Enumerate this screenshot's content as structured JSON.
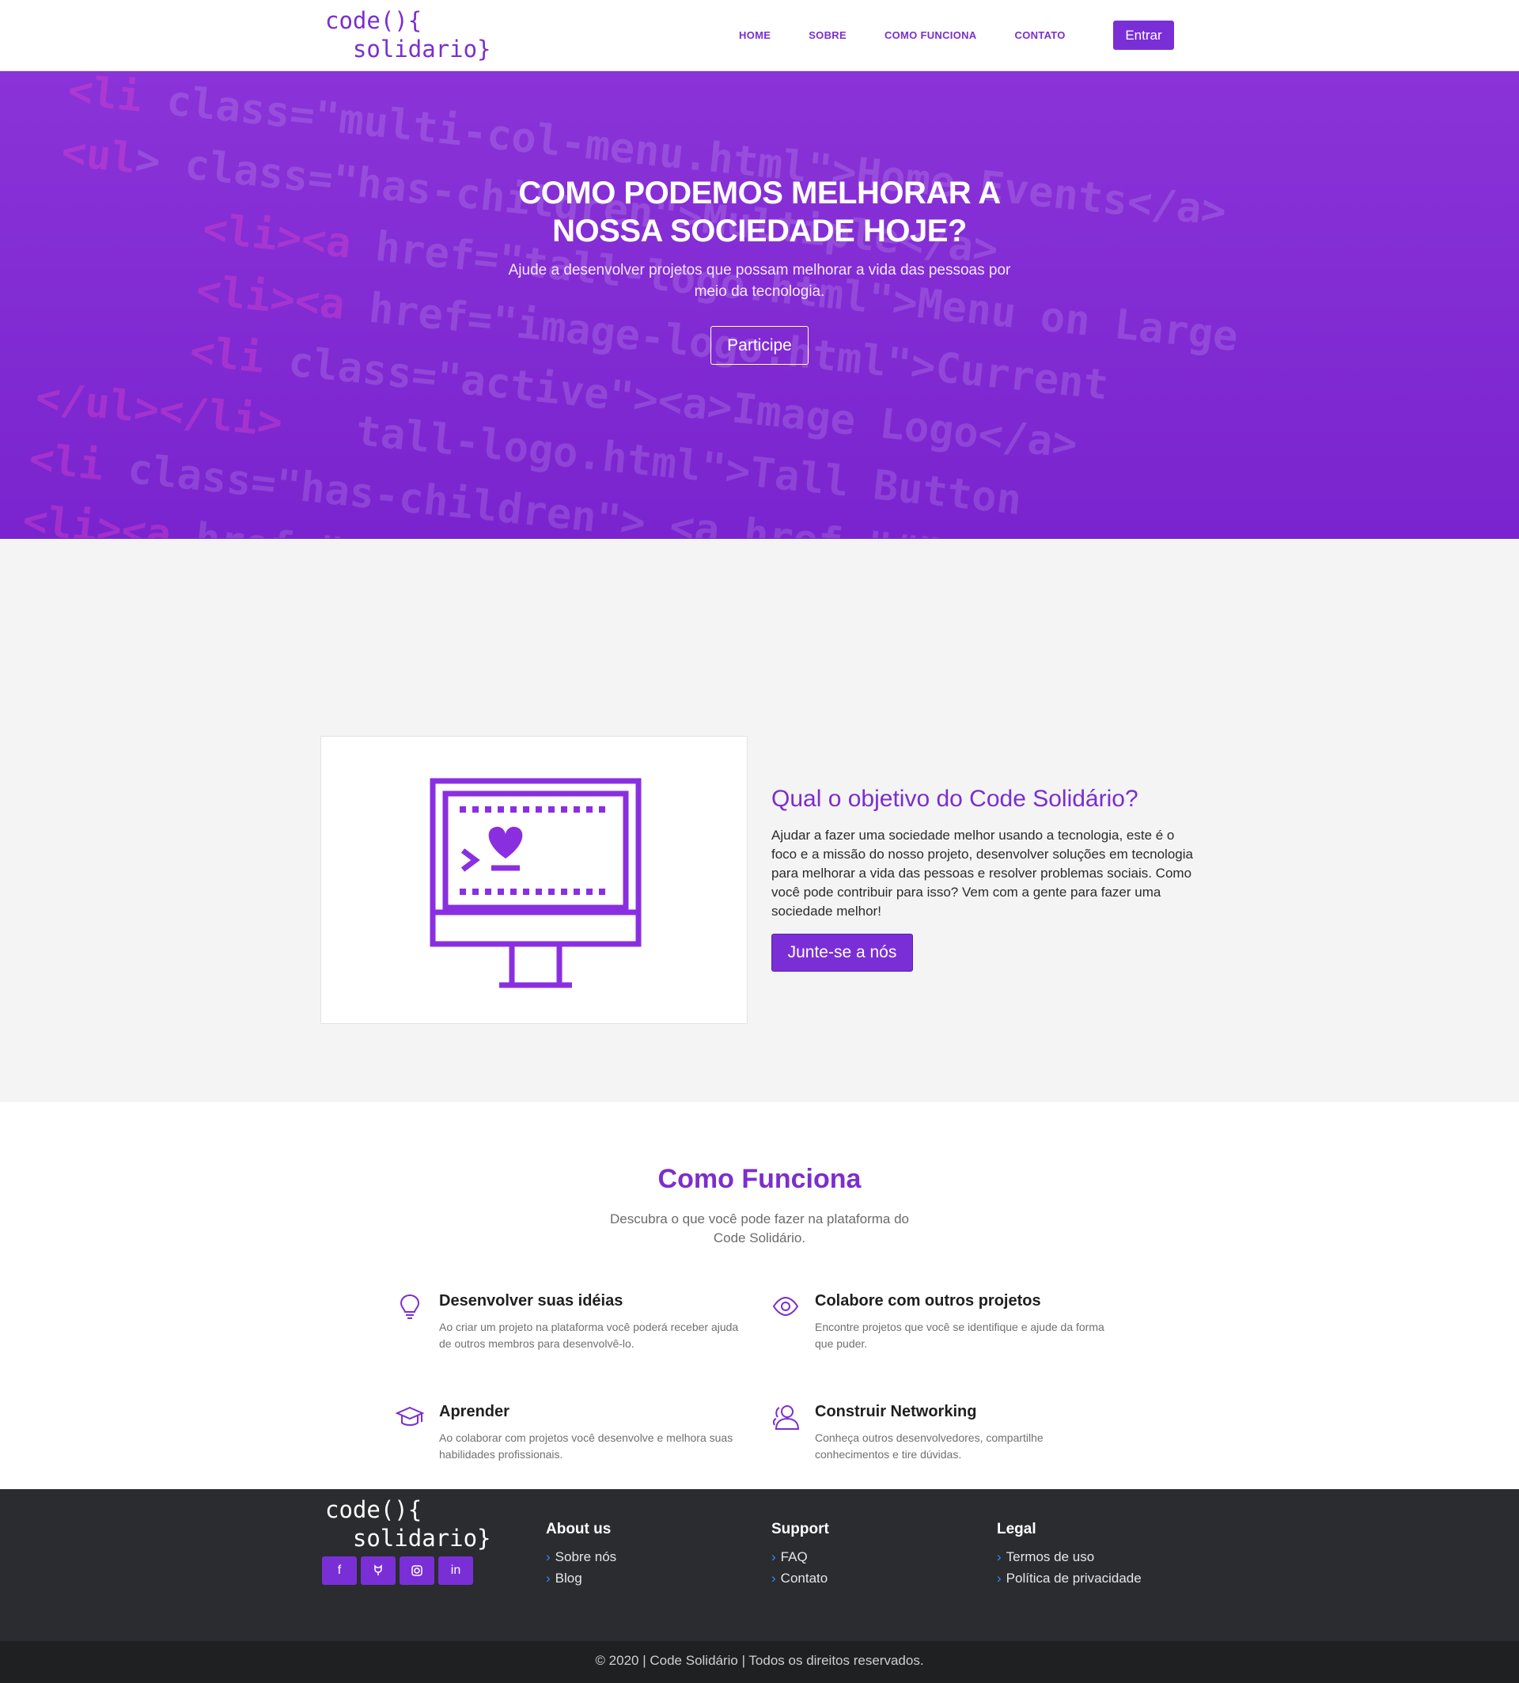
{
  "brand": {
    "logo_text": "code(){\n  solidario}",
    "accent_color": "#7a2fd6"
  },
  "nav": {
    "items": [
      "HOME",
      "SOBRE",
      "COMO FUNCIONA",
      "CONTATO"
    ],
    "login_label": "Entrar"
  },
  "hero": {
    "title_line1": "COMO PODEMOS MELHORAR A",
    "title_line2": "NOSSA SOCIEDADE HOJE?",
    "subtitle": "Ajude a desenvolver projetos que possam melhorar a vida das pessoas por meio da tecnologia.",
    "cta_label": "Participe"
  },
  "objetivo": {
    "illustration_icon": "computer-heart-icon",
    "title": "Qual o objetivo do Code Solidário?",
    "body": "Ajudar a fazer uma sociedade melhor usando a tecnologia, este é o foco e a missão do nosso projeto, desenvolver soluções em tecnologia para melhorar a vida das pessoas e resolver problemas sociais. Como você pode contribuir para isso? Vem com a gente para fazer uma sociedade melhor!",
    "cta_label": "Junte-se a nós"
  },
  "como_funciona": {
    "title": "Como Funciona",
    "subtitle": "Descubra o que você pode fazer na plataforma do Code Solidário.",
    "features": [
      {
        "icon": "lightbulb-icon",
        "title": "Desenvolver suas idéias",
        "body": "Ao criar um projeto na plataforma você poderá receber ajuda de outros membros para desenvolvê-lo."
      },
      {
        "icon": "eye-icon",
        "title": "Colabore com outros projetos",
        "body": "Encontre projetos que você se identifique e ajude da forma que puder."
      },
      {
        "icon": "graduation-cap-icon",
        "title": "Aprender",
        "body": "Ao colaborar com projetos você desenvolve e melhora suas habilidades profissionais."
      },
      {
        "icon": "users-icon",
        "title": "Construir Networking",
        "body": "Conheça outros desenvolvedores, compartilhe conhecimentos e tire dúvidas."
      }
    ]
  },
  "footer": {
    "logo_text": "code(){\n  solidario}",
    "socials": [
      "facebook-icon",
      "github-icon",
      "instagram-icon",
      "linkedin-icon"
    ],
    "columns": [
      {
        "title": "About us",
        "links": [
          "Sobre nós",
          "Blog"
        ]
      },
      {
        "title": "Support",
        "links": [
          "FAQ",
          "Contato"
        ]
      },
      {
        "title": "Legal",
        "links": [
          "Termos de uso",
          "Política de privacidade"
        ]
      }
    ],
    "copyright": "© 2020 | Code Solidário | Todos os direitos reservados."
  }
}
